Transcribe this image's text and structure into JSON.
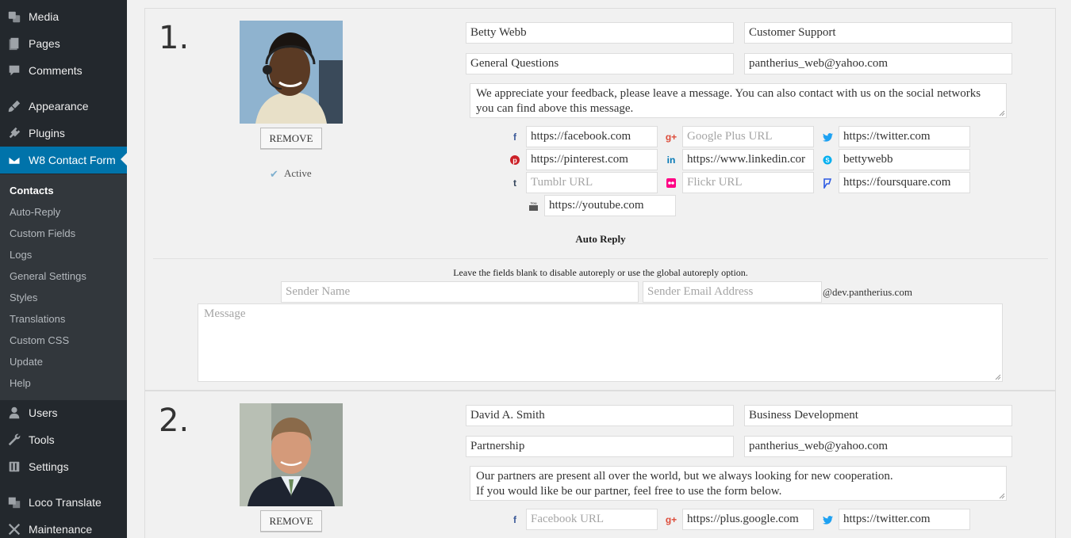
{
  "sidebar": {
    "items_top": [
      {
        "label": "Media",
        "icon": "media-icon"
      },
      {
        "label": "Pages",
        "icon": "pages-icon"
      },
      {
        "label": "Comments",
        "icon": "comments-icon"
      },
      {
        "label": "Appearance",
        "icon": "appearance-icon"
      },
      {
        "label": "Plugins",
        "icon": "plugins-icon"
      },
      {
        "label": "W8 Contact Form",
        "icon": "mail-icon"
      }
    ],
    "submenu": [
      "Contacts",
      "Auto-Reply",
      "Custom Fields",
      "Logs",
      "General Settings",
      "Styles",
      "Translations",
      "Custom CSS",
      "Update",
      "Help"
    ],
    "items_bottom": [
      {
        "label": "Users",
        "icon": "users-icon"
      },
      {
        "label": "Tools",
        "icon": "tools-icon"
      },
      {
        "label": "Settings",
        "icon": "settings-icon"
      },
      {
        "label": "Loco Translate",
        "icon": "translate-icon"
      },
      {
        "label": "Maintenance",
        "icon": "maintenance-icon"
      }
    ],
    "colors": {
      "background": "#23282d",
      "submenu": "#32373c",
      "accent": "#0073aa"
    }
  },
  "contacts": [
    {
      "number": "1.",
      "remove_label": "REMOVE",
      "active_label": "Active",
      "name": "Betty Webb",
      "department": "Customer Support",
      "subject": "General Questions",
      "email": "pantherius_web@yahoo.com",
      "message": "We appreciate your feedback, please leave a message. You can also contact with us on the social networks you can find above this message.",
      "social": {
        "facebook": {
          "value": "https://facebook.com",
          "placeholder": ""
        },
        "googleplus": {
          "value": "",
          "placeholder": "Google Plus URL"
        },
        "twitter": {
          "value": "https://twitter.com",
          "placeholder": ""
        },
        "pinterest": {
          "value": "https://pinterest.com",
          "placeholder": ""
        },
        "linkedin": {
          "value": "https://www.linkedin.cor",
          "placeholder": ""
        },
        "skype": {
          "value": "bettywebb",
          "placeholder": ""
        },
        "tumblr": {
          "value": "",
          "placeholder": "Tumblr URL"
        },
        "flickr": {
          "value": "",
          "placeholder": "Flickr URL"
        },
        "foursquare": {
          "value": "https://foursquare.com",
          "placeholder": ""
        },
        "youtube": {
          "value": "https://youtube.com",
          "placeholder": ""
        }
      },
      "auto_reply": {
        "heading": "Auto Reply",
        "hint": "Leave the fields blank to disable autoreply or use the global autoreply option.",
        "sender_name_placeholder": "Sender Name",
        "sender_email_placeholder": "Sender Email Address",
        "domain_suffix": "@dev.pantherius.com",
        "message_placeholder": "Message"
      }
    },
    {
      "number": "2.",
      "remove_label": "REMOVE",
      "name": "David A. Smith",
      "department": "Business Development",
      "subject": "Partnership",
      "email": "pantherius_web@yahoo.com",
      "message_line1": "Our partners are present all over the world, but we always looking for new cooperation.",
      "message_line2": "If you would like be our partner, feel free to use the form below.",
      "social": {
        "facebook": {
          "value": "",
          "placeholder": "Facebook URL"
        },
        "googleplus": {
          "value": "https://plus.google.com",
          "placeholder": ""
        },
        "twitter": {
          "value": "https://twitter.com",
          "placeholder": ""
        }
      }
    }
  ],
  "icon_colors": {
    "facebook": "#3b5998",
    "googleplus": "#dd4b39",
    "twitter": "#1da1f2",
    "pinterest": "#cb2027",
    "linkedin": "#0077b5",
    "skype": "#00aff0",
    "tumblr": "#35465c",
    "flickr": "#ff0084",
    "foursquare": "#2d5be3",
    "youtube": "#555555"
  }
}
